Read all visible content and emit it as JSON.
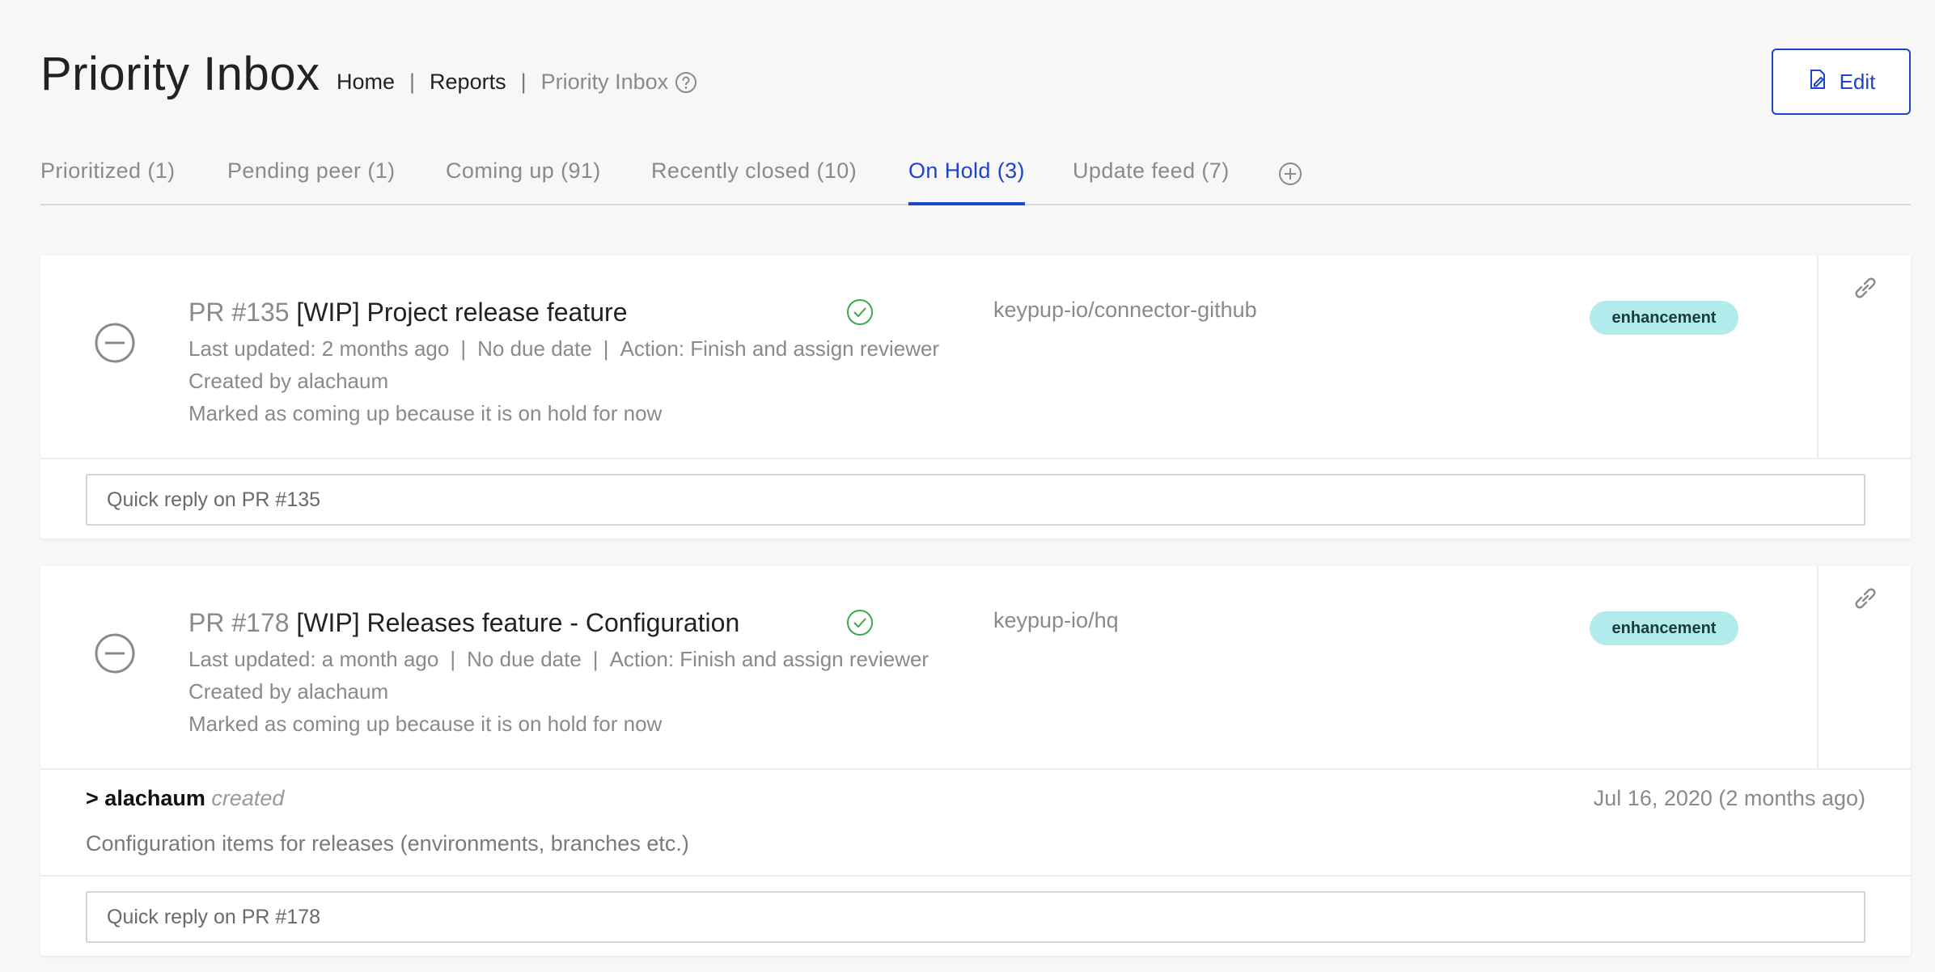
{
  "header": {
    "title": "Priority Inbox",
    "breadcrumb": [
      "Home",
      "Reports",
      "Priority Inbox"
    ],
    "edit_label": "Edit"
  },
  "tabs": [
    {
      "label": "Prioritized (1)"
    },
    {
      "label": "Pending peer (1)"
    },
    {
      "label": "Coming up (91)"
    },
    {
      "label": "Recently closed (10)"
    },
    {
      "label": "On Hold (3)",
      "active": true
    },
    {
      "label": "Update feed (7)"
    }
  ],
  "colors": {
    "accent": "#1c45c9",
    "badge_bg": "#b2ebeb",
    "check": "#3aa84c"
  },
  "items": [
    {
      "number": "PR #135",
      "title": "[WIP] Project release feature",
      "last_updated": "Last updated: 2 months ago",
      "due": "No due date",
      "action": "Action: Finish and assign reviewer",
      "created_by": "Created by alachaum",
      "reason": "Marked as coming up because it is on hold for now",
      "repo": "keypup-io/connector-github",
      "label": "enhancement",
      "reply_placeholder": "Quick reply on PR #135"
    },
    {
      "number": "PR #178",
      "title": "[WIP] Releases feature - Configuration",
      "last_updated": "Last updated: a month ago",
      "due": "No due date",
      "action": "Action: Finish and assign reviewer",
      "created_by": "Created by alachaum",
      "reason": "Marked as coming up because it is on hold for now",
      "repo": "keypup-io/hq",
      "label": "enhancement",
      "activity": {
        "prefix": ">",
        "user": "alachaum",
        "verb": "created",
        "date": "Jul 16, 2020 (2 months ago)",
        "body": "Configuration items for releases (environments, branches etc.)"
      },
      "reply_placeholder": "Quick reply on PR #178"
    }
  ]
}
